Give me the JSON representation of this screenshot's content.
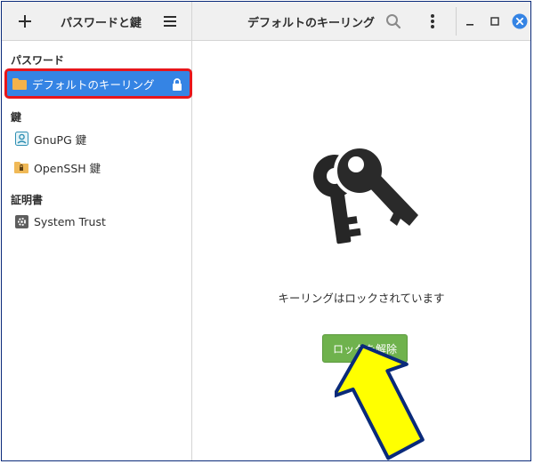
{
  "header": {
    "left_title": "パスワードと鍵",
    "main_title": "デフォルトのキーリング",
    "icons": [
      "plus-icon",
      "hamburger-menu-icon",
      "search-icon",
      "kebab-menu-icon",
      "minimize-icon",
      "maximize-icon",
      "close-icon"
    ]
  },
  "sidebar": {
    "sections": [
      {
        "label": "パスワード",
        "items": [
          {
            "label": "デフォルトのキーリング",
            "icon": "folder-icon",
            "selected": true,
            "locked": true
          }
        ]
      },
      {
        "label": "鍵",
        "items": [
          {
            "label": "GnuPG 鍵",
            "icon": "gnupg-key-icon"
          },
          {
            "label": "OpenSSH 鍵",
            "icon": "ssh-folder-icon"
          }
        ]
      },
      {
        "label": "証明書",
        "items": [
          {
            "label": "System Trust",
            "icon": "gear-icon"
          }
        ]
      }
    ]
  },
  "main": {
    "status_text": "キーリングはロックされています",
    "unlock_label": "ロックを解除"
  },
  "colors": {
    "accent": "#3584e4",
    "highlight_border": "#e8161b",
    "unlock_button": "#6fb24d",
    "arrow_fill": "#ffff00",
    "arrow_stroke": "#0a2a7a"
  }
}
